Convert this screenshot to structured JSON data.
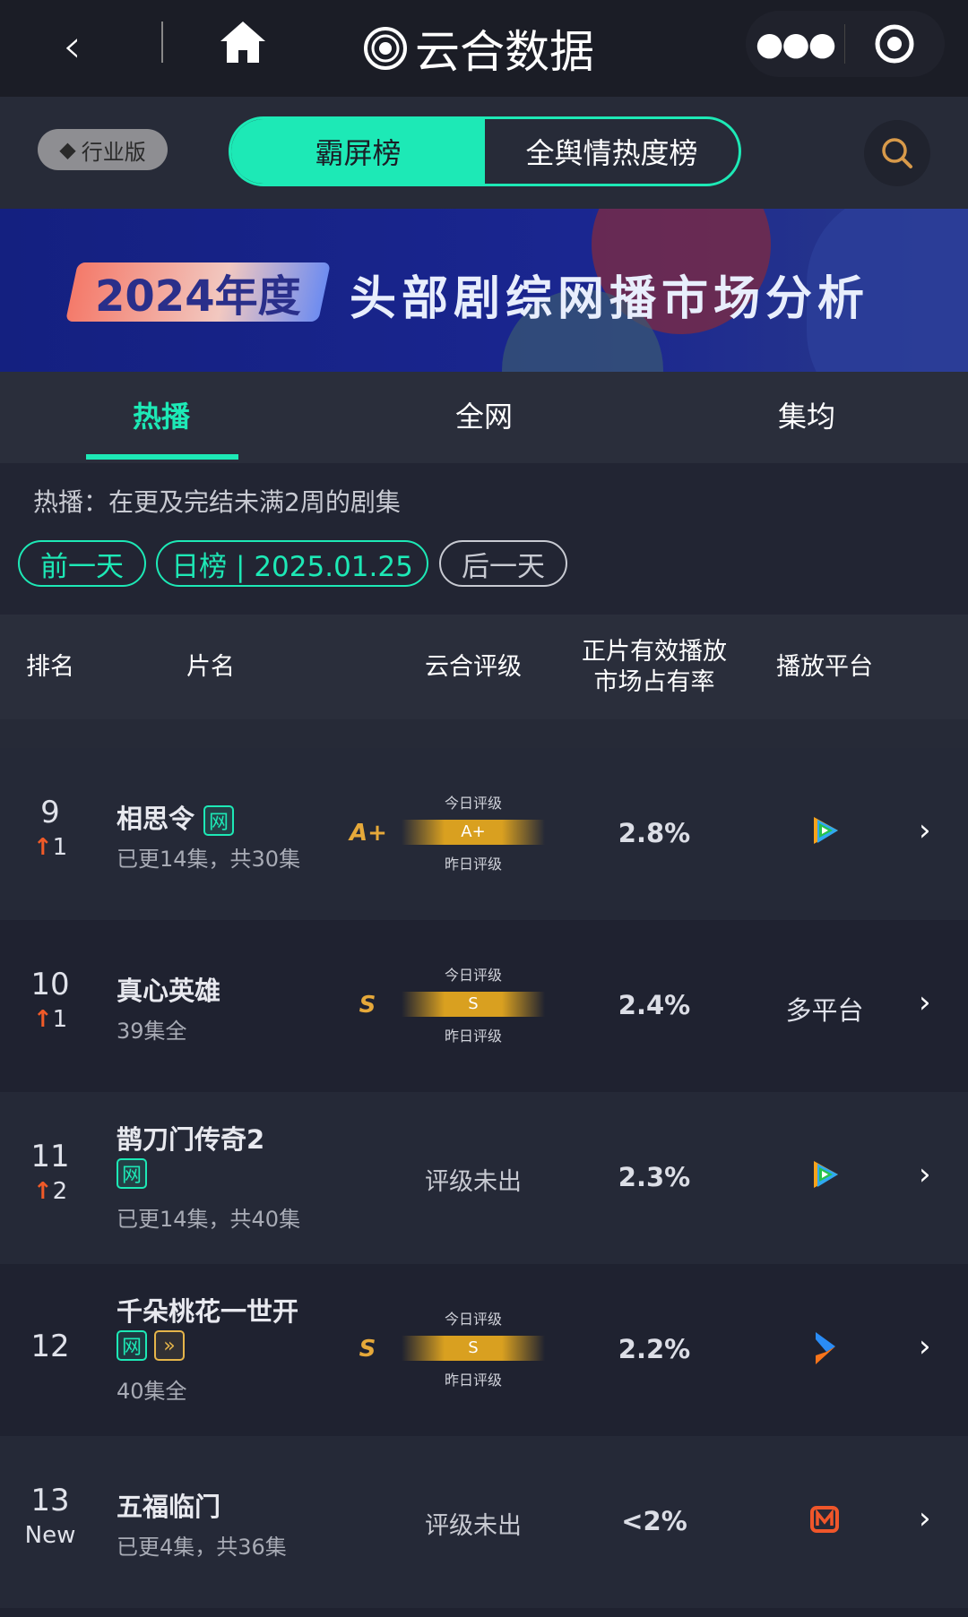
{
  "app": {
    "title": "云合数据"
  },
  "toolbar": {
    "edition": "行业版",
    "segments": [
      "霸屏榜",
      "全舆情热度榜"
    ],
    "active_segment": "霸屏榜"
  },
  "banner": {
    "year_label": "2024年度",
    "title": "头部剧综网播市场分析"
  },
  "tabs": [
    {
      "label": "热播",
      "active": true
    },
    {
      "label": "全网"
    },
    {
      "label": "集均"
    }
  ],
  "description": "热播：在更及完结未满2周的剧集",
  "date_nav": {
    "prev": "前一天",
    "current": "日榜 | 2025.01.25",
    "next": "后一天"
  },
  "table_header": {
    "rank": "排名",
    "title": "片名",
    "rating": "云合评级",
    "share_line1": "正片有效播放",
    "share_line2": "市场占有率",
    "platform": "播放平台"
  },
  "rating_labels": {
    "today": "今日评级",
    "yesterday": "昨日评级"
  },
  "colors": {
    "accent": "#1de9b6",
    "rank_up": "#f05a28",
    "rating": "#e6a93a"
  },
  "rows": [
    {
      "rank": "9",
      "change": "1",
      "change_dir": "up",
      "title": "相思令",
      "badges": [
        "网"
      ],
      "episodes": "已更14集，共30集",
      "rating": "A+",
      "share": "2.8%",
      "platform_icon": "tencent-video-icon"
    },
    {
      "rank": "10",
      "change": "1",
      "change_dir": "up",
      "title": "真心英雄",
      "badges": [],
      "episodes": "39集全",
      "rating": "S",
      "share": "2.4%",
      "platform_text": "多平台"
    },
    {
      "rank": "11",
      "change": "2",
      "change_dir": "up",
      "title": "鹊刀门传奇2",
      "badges": [
        "网"
      ],
      "episodes": "已更14集，共40集",
      "rating_text": "评级未出",
      "share": "2.3%",
      "platform_icon": "tencent-video-icon"
    },
    {
      "rank": "12",
      "title": "千朵桃花一世开",
      "badges": [
        "网",
        "»"
      ],
      "episodes": "40集全",
      "rating": "S",
      "share": "2.2%",
      "platform_icon": "youku-icon"
    },
    {
      "rank": "13",
      "change": "New",
      "change_dir": "new",
      "title": "五福临门",
      "badges": [],
      "episodes": "已更4集，共36集",
      "rating_text": "评级未出",
      "share": "<2%",
      "platform_icon": "mango-tv-icon"
    }
  ]
}
